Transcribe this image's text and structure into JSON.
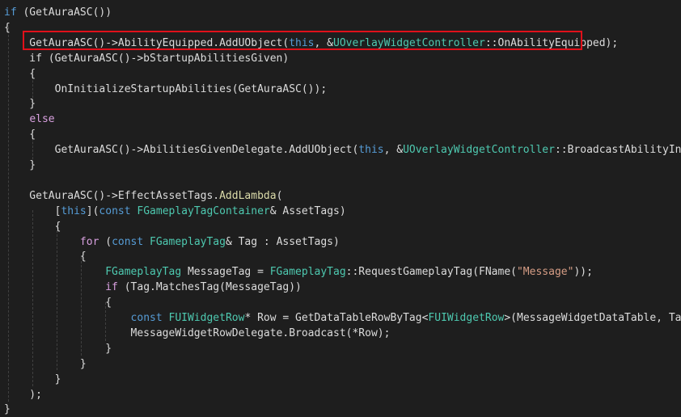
{
  "colors": {
    "background": "#1e1e1e",
    "default": "#dcdcdc",
    "keyword": "#569cd6",
    "control": "#d8a0df",
    "type": "#4ec9b0",
    "function": "#dcdcaa",
    "variable": "#9cdcfe",
    "string": "#d69d85",
    "member": "#dadada",
    "punct": "#b4b4b4",
    "highlight_border": "#e0101a",
    "guide": "#404040"
  },
  "code": {
    "lines": [
      [
        {
          "t": "if",
          "c": "keyword"
        },
        {
          "t": " (GetAuraASC())",
          "c": "default"
        }
      ],
      [
        {
          "t": "{",
          "c": "default"
        }
      ],
      [
        {
          "t": "    GetAuraASC()->AbilityEquipped.AddUObject(",
          "c": "default"
        },
        {
          "t": "this",
          "c": "keyword"
        },
        {
          "t": ", &",
          "c": "default"
        },
        {
          "t": "UOverlayWidgetController",
          "c": "type"
        },
        {
          "t": "::OnAbilityEquipped);",
          "c": "default"
        }
      ],
      [
        {
          "t": "    if (GetAuraASC()->bStartupAbilitiesGiven)",
          "c": "default"
        }
      ],
      [
        {
          "t": "    {",
          "c": "default"
        }
      ],
      [
        {
          "t": "        OnInitializeStartupAbilities(GetAuraASC());",
          "c": "default"
        }
      ],
      [
        {
          "t": "    }",
          "c": "default"
        }
      ],
      [
        {
          "t": "    ",
          "c": "default"
        },
        {
          "t": "else",
          "c": "control"
        }
      ],
      [
        {
          "t": "    {",
          "c": "default"
        }
      ],
      [
        {
          "t": "        GetAuraASC()->AbilitiesGivenDelegate.AddUObject(",
          "c": "default"
        },
        {
          "t": "this",
          "c": "keyword"
        },
        {
          "t": ", &",
          "c": "default"
        },
        {
          "t": "UOverlayWidgetController",
          "c": "type"
        },
        {
          "t": "::BroadcastAbilityInfo);",
          "c": "default"
        }
      ],
      [
        {
          "t": "    }",
          "c": "default"
        }
      ],
      [
        {
          "t": "",
          "c": "default"
        }
      ],
      [
        {
          "t": "    GetAuraASC()->EffectAssetTags.",
          "c": "default"
        },
        {
          "t": "AddLambda",
          "c": "function"
        },
        {
          "t": "(",
          "c": "default"
        }
      ],
      [
        {
          "t": "        [",
          "c": "default"
        },
        {
          "t": "this",
          "c": "keyword"
        },
        {
          "t": "](",
          "c": "default"
        },
        {
          "t": "const",
          "c": "keyword"
        },
        {
          "t": " ",
          "c": "default"
        },
        {
          "t": "FGameplayTagContainer",
          "c": "type"
        },
        {
          "t": "& AssetTags)",
          "c": "default"
        }
      ],
      [
        {
          "t": "        {",
          "c": "default"
        }
      ],
      [
        {
          "t": "            ",
          "c": "default"
        },
        {
          "t": "for",
          "c": "control"
        },
        {
          "t": " (",
          "c": "default"
        },
        {
          "t": "const",
          "c": "keyword"
        },
        {
          "t": " ",
          "c": "default"
        },
        {
          "t": "FGameplayTag",
          "c": "type"
        },
        {
          "t": "& Tag : AssetTags)",
          "c": "default"
        }
      ],
      [
        {
          "t": "            {",
          "c": "default"
        }
      ],
      [
        {
          "t": "                ",
          "c": "default"
        },
        {
          "t": "FGameplayTag",
          "c": "type"
        },
        {
          "t": " MessageTag = ",
          "c": "default"
        },
        {
          "t": "FGameplayTag",
          "c": "type"
        },
        {
          "t": "::RequestGameplayTag(FName(",
          "c": "default"
        },
        {
          "t": "\"Message\"",
          "c": "string"
        },
        {
          "t": "));",
          "c": "default"
        }
      ],
      [
        {
          "t": "                ",
          "c": "default"
        },
        {
          "t": "if",
          "c": "control"
        },
        {
          "t": " (Tag.MatchesTag(MessageTag))",
          "c": "default"
        }
      ],
      [
        {
          "t": "                {",
          "c": "default"
        }
      ],
      [
        {
          "t": "                    ",
          "c": "default"
        },
        {
          "t": "const",
          "c": "keyword"
        },
        {
          "t": " ",
          "c": "default"
        },
        {
          "t": "FUIWidgetRow",
          "c": "type"
        },
        {
          "t": "* Row = GetDataTableRowByTag<",
          "c": "default"
        },
        {
          "t": "FUIWidgetRow",
          "c": "type"
        },
        {
          "t": ">(MessageWidgetDataTable, Tag);",
          "c": "default"
        }
      ],
      [
        {
          "t": "                    MessageWidgetRowDelegate.Broadcast(*Row);",
          "c": "default"
        }
      ],
      [
        {
          "t": "                }",
          "c": "default"
        }
      ],
      [
        {
          "t": "            }",
          "c": "default"
        }
      ],
      [
        {
          "t": "        }",
          "c": "default"
        }
      ],
      [
        {
          "t": "    );",
          "c": "default"
        }
      ],
      [
        {
          "t": "}",
          "c": "default"
        }
      ]
    ]
  }
}
